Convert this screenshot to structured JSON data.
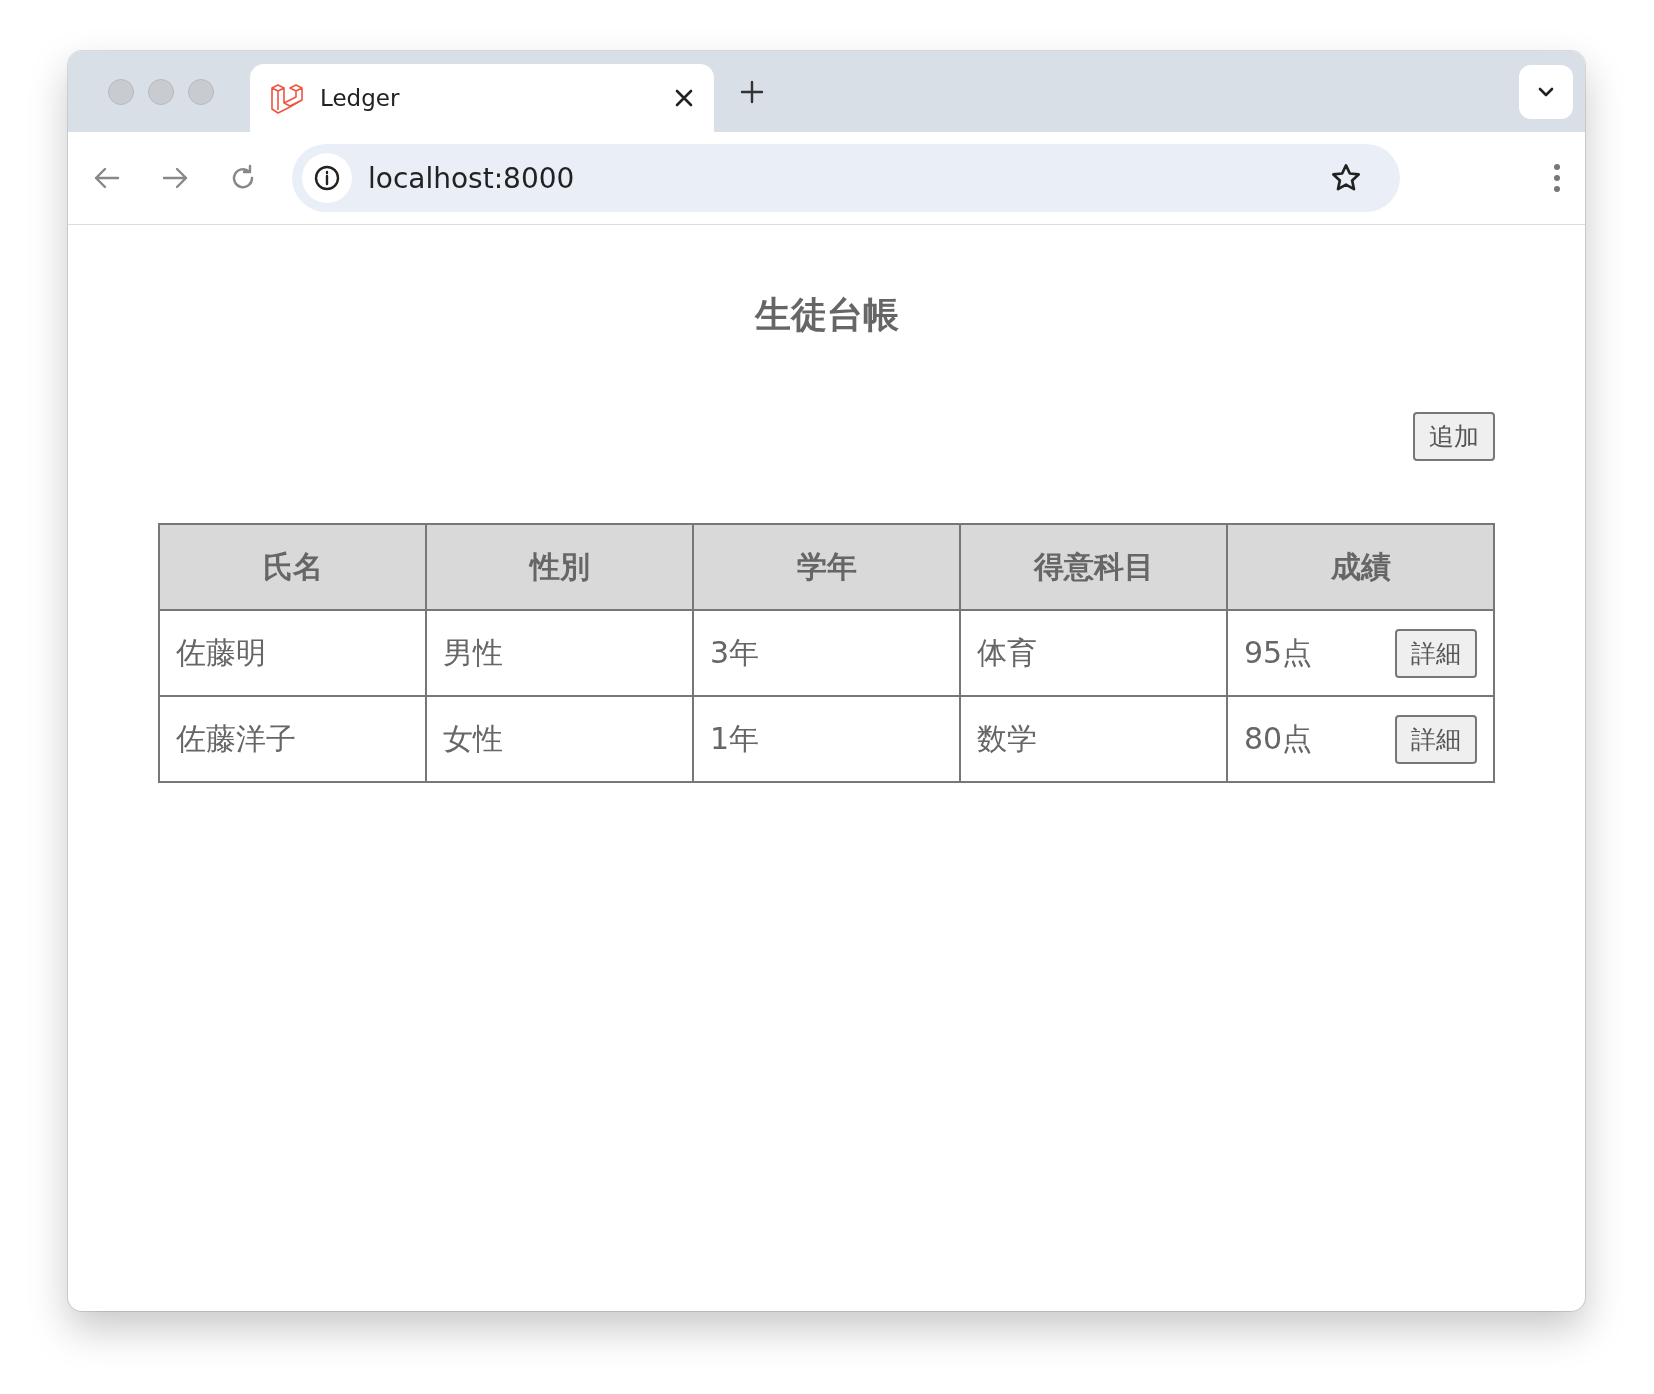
{
  "browser": {
    "tab": {
      "title": "Ledger",
      "selected": true
    },
    "address": "localhost:8000"
  },
  "page": {
    "title": "生徒台帳",
    "add_button": "追加",
    "table": {
      "columns": [
        "氏名",
        "性別",
        "学年",
        "得意科目",
        "成績"
      ],
      "rows": [
        {
          "name": "佐藤明",
          "gender": "男性",
          "grade": "3年",
          "subject": "体育",
          "score": "95点",
          "action": "詳細"
        },
        {
          "name": "佐藤洋子",
          "gender": "女性",
          "grade": "1年",
          "subject": "数学",
          "score": "80点",
          "action": "詳細"
        }
      ]
    }
  }
}
